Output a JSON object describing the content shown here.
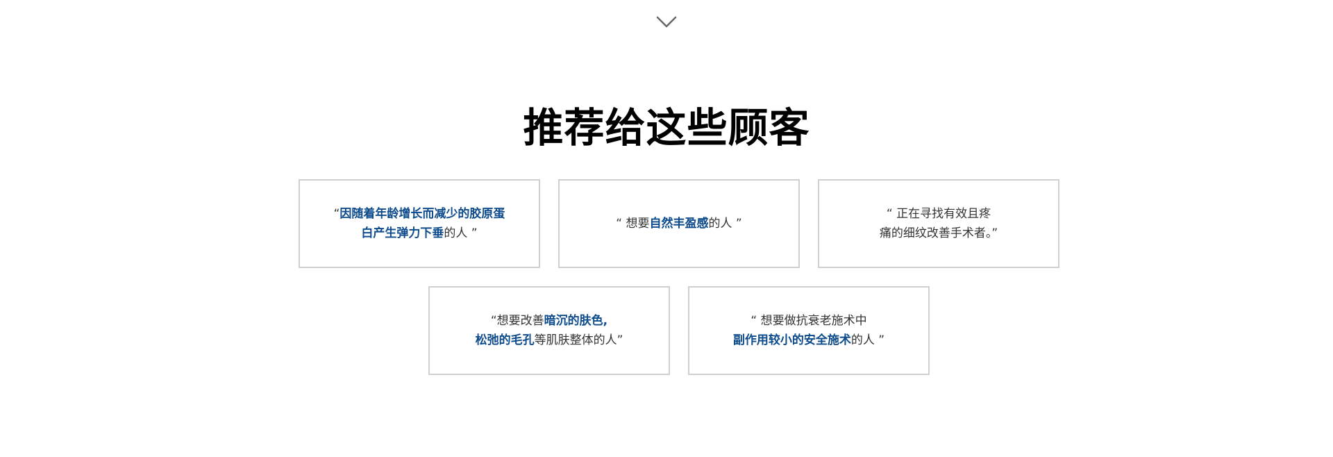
{
  "icons": {
    "scroll_down": "chevron-down-icon"
  },
  "colors": {
    "highlight": "#0d4b8c",
    "text": "#333333",
    "title": "#000000",
    "card_border": "#cfcfcf",
    "chevron": "#666666"
  },
  "section": {
    "title": "推荐给这些顾客"
  },
  "cards": [
    {
      "line1": {
        "pre": "“",
        "hl": "因随着年龄增长而减少的胶原蛋",
        "post": ""
      },
      "line2": {
        "pre": "",
        "hl": "白产生弹力下垂",
        "post": "的人 ”"
      }
    },
    {
      "line1": {
        "pre": "“ 想要",
        "hl": "自然丰盈感",
        "post": "的人 ”"
      }
    },
    {
      "line1": {
        "pre": "“ 正在寻找有效且疼",
        "hl": "",
        "post": ""
      },
      "line2": {
        "pre": "痛的细纹改善手术者。”",
        "hl": "",
        "post": ""
      }
    },
    {
      "line1": {
        "pre": "“想要改善",
        "hl": "暗沉的肤色,",
        "post": ""
      },
      "line2": {
        "pre": "",
        "hl": "松弛的毛孔",
        "post": "等肌肤整体的人”"
      }
    },
    {
      "line1": {
        "pre": "“ 想要做抗衰老施术中",
        "hl": "",
        "post": ""
      },
      "line2": {
        "pre": "",
        "hl": "副作用较小的安全施术",
        "post": "的人 ”"
      }
    }
  ]
}
